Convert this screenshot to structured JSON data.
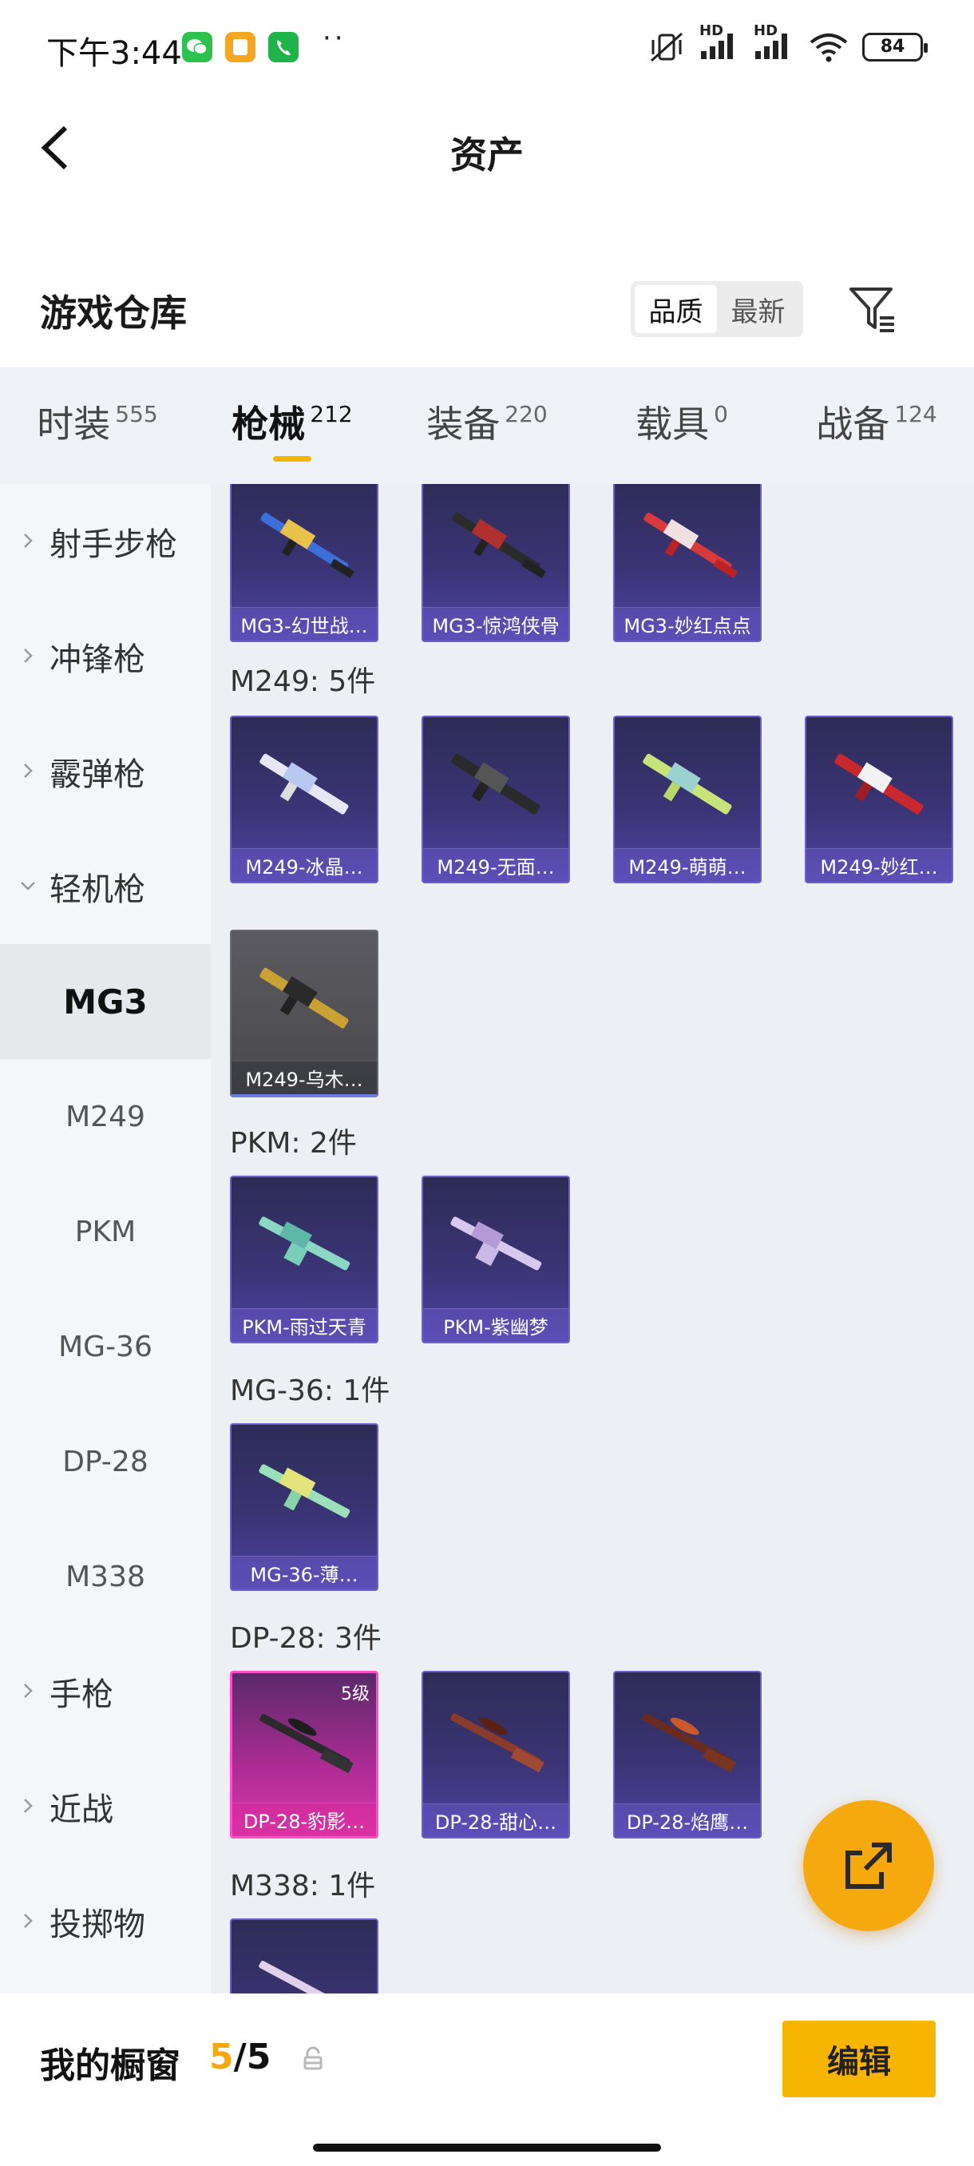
{
  "status_bar": {
    "time": "下午3:44",
    "dots": "··",
    "network_1": "HD",
    "network_2": "HD",
    "battery": "84",
    "colors": {
      "wechat": "#2dc24e",
      "notes": "#f5a623",
      "phone": "#1fb34a"
    }
  },
  "nav": {
    "title": "资产"
  },
  "warehouse": {
    "title": "游戏仓库",
    "sort": [
      "品质",
      "最新"
    ],
    "sort_selected": "品质"
  },
  "tabs": [
    {
      "label": "时装",
      "count": "555"
    },
    {
      "label": "枪械",
      "count": "212",
      "active": true
    },
    {
      "label": "装备",
      "count": "220"
    },
    {
      "label": "载具",
      "count": "0"
    },
    {
      "label": "战备",
      "count": "124"
    }
  ],
  "sidebar": [
    {
      "label": "射手步枪",
      "type": "category",
      "expanded": false
    },
    {
      "label": "冲锋枪",
      "type": "category",
      "expanded": false
    },
    {
      "label": "霰弹枪",
      "type": "category",
      "expanded": false
    },
    {
      "label": "轻机枪",
      "type": "category",
      "expanded": true
    },
    {
      "label": "MG3",
      "type": "sub",
      "selected": true
    },
    {
      "label": "M249",
      "type": "sub"
    },
    {
      "label": "PKM",
      "type": "sub"
    },
    {
      "label": "MG-36",
      "type": "sub"
    },
    {
      "label": "DP-28",
      "type": "sub"
    },
    {
      "label": "M338",
      "type": "sub"
    },
    {
      "label": "手枪",
      "type": "category",
      "expanded": false
    },
    {
      "label": "近战",
      "type": "category",
      "expanded": false
    },
    {
      "label": "投掷物",
      "type": "category",
      "expanded": false
    }
  ],
  "groups": {
    "mg3": {
      "items": [
        "MG3-幻世战…",
        "MG3-惊鸿侠骨",
        "MG3-妙红点点"
      ]
    },
    "m249": {
      "label": "M249: 5件",
      "items": [
        "M249-冰晶…",
        "M249-无面…",
        "M249-萌萌…",
        "M249-妙红…",
        "M249-乌木…"
      ]
    },
    "pkm": {
      "label": "PKM: 2件",
      "items": [
        "PKM-雨过天青",
        "PKM-紫幽梦"
      ]
    },
    "mg36": {
      "label": "MG-36: 1件",
      "items": [
        "MG-36-薄…"
      ]
    },
    "dp28": {
      "label": "DP-28: 3件",
      "items": [
        "DP-28-豹影…",
        "DP-28-甜心…",
        "DP-28-焰鹰…"
      ],
      "level": "5级"
    },
    "m338": {
      "label": "M338: 1件"
    }
  },
  "bottom": {
    "label": "我的橱窗",
    "count_current": "5",
    "count_total": "/5",
    "edit": "编辑"
  }
}
